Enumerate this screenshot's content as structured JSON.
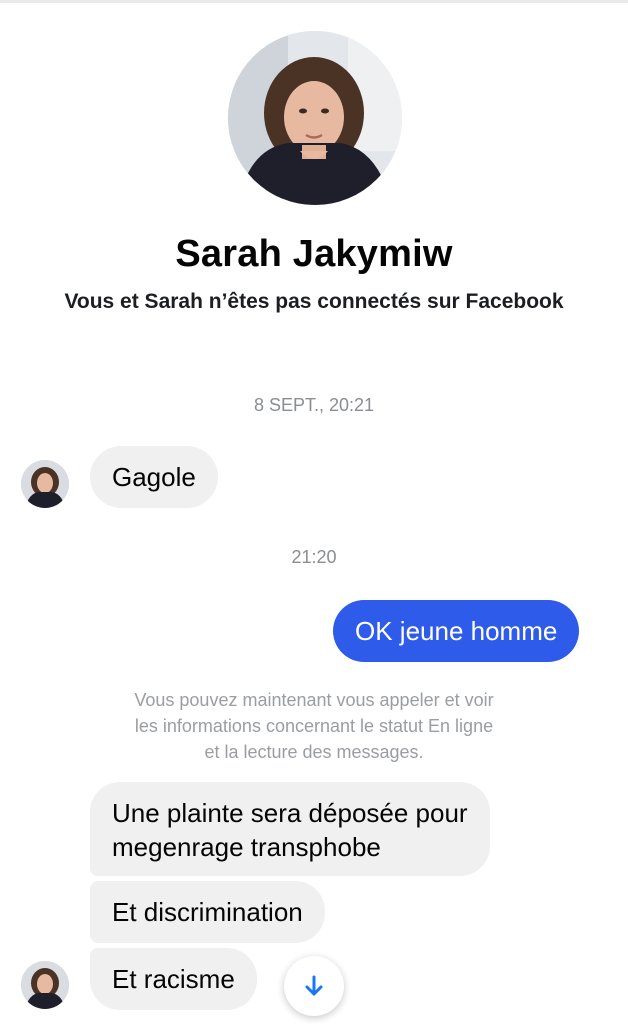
{
  "contact": {
    "name": "Sarah Jakymiw",
    "connection_notice": "Vous et Sarah n’êtes pas connectés sur Facebook"
  },
  "thread": {
    "timestamp_1": "8 SEPT., 20:21",
    "timestamp_2": "21:20",
    "messages": [
      {
        "direction": "incoming",
        "text": "Gagole"
      },
      {
        "direction": "outgoing",
        "text": "OK jeune homme"
      },
      {
        "direction": "incoming",
        "lines": [
          "Une plainte sera déposée pour",
          "megenrage transphobe"
        ]
      },
      {
        "direction": "incoming",
        "text": "Et discrimination"
      },
      {
        "direction": "incoming",
        "text": "Et racisme"
      }
    ],
    "system_notice_lines": [
      "Vous pouvez maintenant vous appeler et voir",
      "les informations concernant le statut En ligne",
      "et la lecture des messages."
    ]
  },
  "icons": {
    "scroll_down": "arrow-down-icon",
    "avatar": "contact-avatar"
  },
  "colors": {
    "outgoing_bubble": "#2f5bea",
    "incoming_bubble": "#f0f0f0",
    "accent": "#1877f2"
  }
}
